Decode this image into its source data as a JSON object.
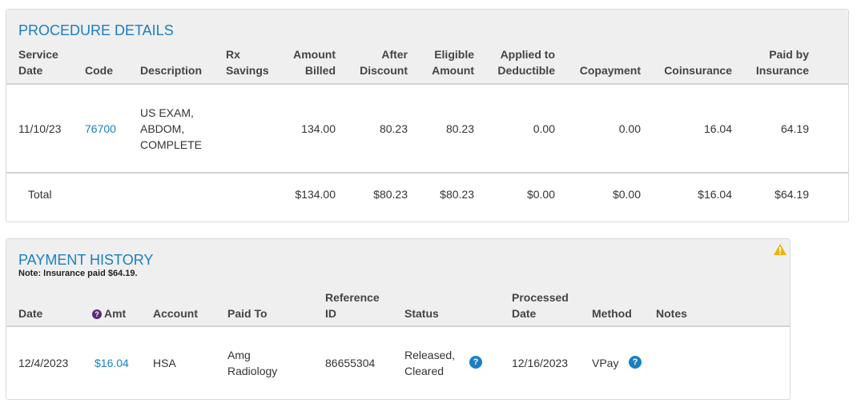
{
  "procedure": {
    "title": "PROCEDURE DETAILS",
    "headers": {
      "service_date": [
        "Service",
        "Date"
      ],
      "code": "Code",
      "description": "Description",
      "rx_savings": [
        "Rx",
        "Savings"
      ],
      "amount_billed": [
        "Amount",
        "Billed"
      ],
      "after_discount": [
        "After",
        "Discount"
      ],
      "eligible_amount": [
        "Eligible",
        "Amount"
      ],
      "applied_to_deductible": [
        "Applied to",
        "Deductible"
      ],
      "copayment": "Copayment",
      "coinsurance": "Coinsurance",
      "paid_by_insurance": [
        "Paid by",
        "Insurance"
      ]
    },
    "row": {
      "service_date": "11/10/23",
      "code": "76700",
      "description": [
        "US EXAM,",
        "ABDOM,",
        "COMPLETE"
      ],
      "amount_billed": "134.00",
      "after_discount": "80.23",
      "eligible_amount": "80.23",
      "applied_to_deductible": "0.00",
      "copayment": "0.00",
      "coinsurance": "16.04",
      "paid_by_insurance": "64.19"
    },
    "total": {
      "label": "Total",
      "amount_billed": "$134.00",
      "after_discount": "$80.23",
      "eligible_amount": "$80.23",
      "applied_to_deductible": "$0.00",
      "copayment": "$0.00",
      "coinsurance": "$16.04",
      "paid_by_insurance": "$64.19"
    }
  },
  "payment": {
    "title": "PAYMENT HISTORY",
    "note": "Note: Insurance paid $64.19.",
    "headers": {
      "date": "Date",
      "amt": "Amt",
      "account": "Account",
      "paid_to": "Paid To",
      "reference_id": [
        "Reference",
        "ID"
      ],
      "status": "Status",
      "processed_date": [
        "Processed",
        "Date"
      ],
      "method": "Method",
      "notes": "Notes"
    },
    "row": {
      "date": "12/4/2023",
      "amt": "$16.04",
      "account": "HSA",
      "paid_to": [
        "Amg",
        "Radiology"
      ],
      "reference_id": "86655304",
      "status": [
        "Released,",
        "Cleared"
      ],
      "processed_date": "12/16/2023",
      "method": "VPay",
      "notes": ""
    },
    "icons": {
      "warning": "warning-icon",
      "amt_help": "help-icon",
      "status_help": "help-icon",
      "method_help": "help-icon"
    }
  },
  "colors": {
    "accent": "#1a7fc1",
    "warning": "#f0b400",
    "help_dark": "#5b2a7a"
  }
}
